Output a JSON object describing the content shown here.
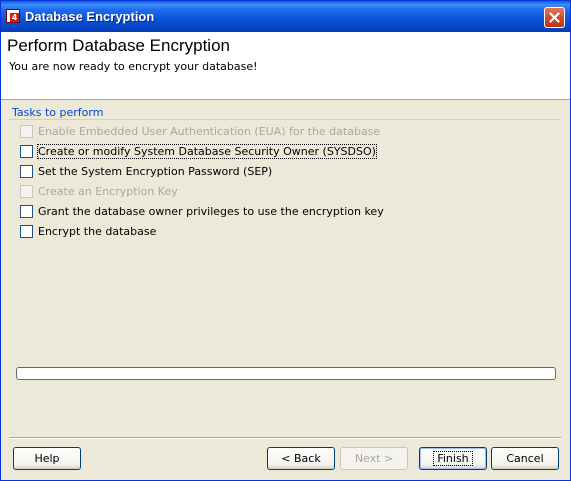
{
  "window": {
    "title": "Database Encryption",
    "app_icon_badge": "4"
  },
  "header": {
    "title": "Perform Database Encryption",
    "subtitle": "You are now ready to encrypt your database!"
  },
  "tasks": {
    "group_label": "Tasks to perform",
    "items": [
      {
        "label": "Enable Embedded User Authentication (EUA) for the database",
        "enabled": false,
        "checked": false
      },
      {
        "label": "Create or modify System Database Security Owner (SYSDSO)",
        "enabled": true,
        "checked": false,
        "focused": true
      },
      {
        "label": "Set the System Encryption Password (SEP)",
        "enabled": true,
        "checked": false
      },
      {
        "label": "Create an Encryption Key",
        "enabled": false,
        "checked": false
      },
      {
        "label": "Grant the database owner privileges to use the encryption key",
        "enabled": true,
        "checked": false
      },
      {
        "label": "Encrypt the database",
        "enabled": true,
        "checked": false
      }
    ]
  },
  "progress": {
    "value": 0
  },
  "buttons": {
    "help": "Help",
    "back": "< Back",
    "next": "Next >",
    "finish": "Finish",
    "cancel": "Cancel"
  }
}
